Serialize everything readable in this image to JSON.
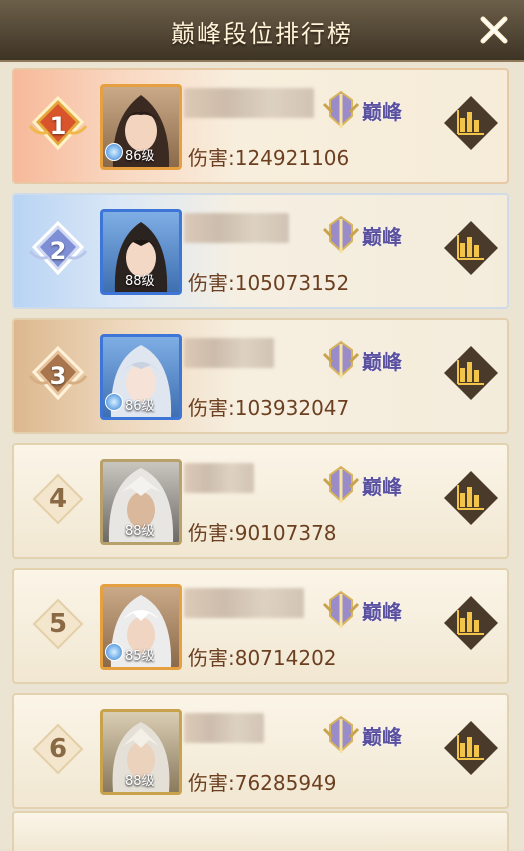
{
  "header": {
    "title": "巅峰段位排行榜",
    "close_icon": "close-icon"
  },
  "colors": {
    "header_bg": "#4e4331",
    "tier_text": "#5a50a0",
    "damage_text": "#6b3f20"
  },
  "rows": [
    {
      "rank": "1",
      "level": "86级",
      "damage": "伤害:124921106",
      "tier": "巅峰",
      "name_blur_width": 130
    },
    {
      "rank": "2",
      "level": "88级",
      "damage": "伤害:105073152",
      "tier": "巅峰",
      "name_blur_width": 105
    },
    {
      "rank": "3",
      "level": "86级",
      "damage": "伤害:103932047",
      "tier": "巅峰",
      "name_blur_width": 90
    },
    {
      "rank": "4",
      "level": "88级",
      "damage": "伤害:90107378",
      "tier": "巅峰",
      "name_blur_width": 70
    },
    {
      "rank": "5",
      "level": "85级",
      "damage": "伤害:80714202",
      "tier": "巅峰",
      "name_blur_width": 120
    },
    {
      "rank": "6",
      "level": "88级",
      "damage": "伤害:76285949",
      "tier": "巅峰",
      "name_blur_width": 80
    }
  ]
}
